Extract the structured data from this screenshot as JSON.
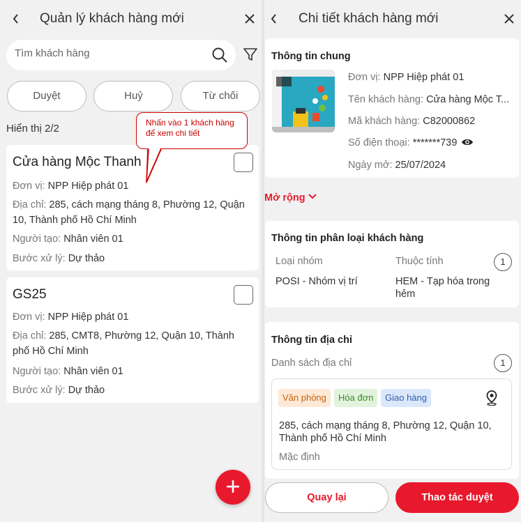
{
  "left": {
    "title": "Quản lý khách hàng mới",
    "back_icon": "chevron-left-icon",
    "close_icon": "close-icon",
    "search": {
      "placeholder": "Tìm khách hàng",
      "value": ""
    },
    "chips": [
      "Duyệt",
      "Huỷ",
      "Từ chối"
    ],
    "count_text": "Hiển thị 2/2",
    "callout": "Nhấn vào 1 khách hàng để xem chi tiết",
    "customers": [
      {
        "name": "Cửa hàng Mộc Thanh",
        "unit_label": "Đơn vị:",
        "unit_value": "NPP Hiệp phát 01",
        "address_label": "Địa chỉ:",
        "address_value": "285, cách mạng tháng 8, Phường 12, Quận 10, Thành phố Hồ Chí Minh",
        "creator_label": "Người tạo:",
        "creator_value": "Nhân viên 01",
        "step_label": "Bước xử lý:",
        "step_value": "Dự thảo"
      },
      {
        "name": "GS25",
        "unit_label": "Đơn vị:",
        "unit_value": "NPP Hiệp phát 01",
        "address_label": "Địa chỉ:",
        "address_value": "285, CMT8, Phường 12, Quận 10, Thành phố Hồ Chí Minh",
        "creator_label": "Người tạo:",
        "creator_value": "Nhân viên 01",
        "step_label": "Bước xử lý:",
        "step_value": "Dự thảo"
      }
    ],
    "fab_label": "+"
  },
  "right": {
    "title": "Chi tiết khách hàng mới",
    "general": {
      "title": "Thông tin chung",
      "unit_label": "Đơn vị:",
      "unit_value": "NPP Hiệp phát 01",
      "name_label": "Tên khách hàng:",
      "name_value": "Cửa hàng Mộc T...",
      "code_label": "Mã khách hàng:",
      "code_value": "C82000862",
      "phone_label": "Số điện thoại:",
      "phone_value": "*******739",
      "date_label": "Ngày mở:",
      "date_value": "25/07/2024"
    },
    "expand_label": "Mở rộng",
    "classification": {
      "title": "Thông tin phân loại khách hàng",
      "col1_label": "Loại nhóm",
      "col2_label": "Thuộc tính",
      "count": "1",
      "col1_value": "POSI - Nhóm vị trí",
      "col2_value": "HEM - Tạp hóa trong hẻm"
    },
    "address": {
      "title": "Thông tin địa chỉ",
      "list_label": "Danh sách địa chỉ",
      "count": "1",
      "tags": [
        "Văn phòng",
        "Hóa đơn",
        "Giao hàng"
      ],
      "text": "285, cách mạng tháng 8, Phường 12, Quận 10, Thành phố Hồ Chí Minh",
      "default_label": "Mặc định"
    },
    "buttons": {
      "back": "Quay lại",
      "approve": "Thao tác duyệt"
    }
  },
  "colors": {
    "accent": "#e8192c",
    "callout": "#cc0000",
    "tag_office": "#fde9d6",
    "tag_invoice": "#e2f3dc",
    "tag_delivery": "#dbe8fb"
  }
}
